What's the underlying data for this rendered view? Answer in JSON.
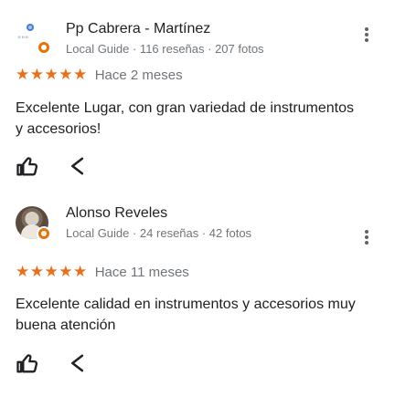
{
  "reviews": [
    {
      "name": "Pp Cabrera - Martínez",
      "meta": "Local Guide · 116 reseñas · 207 fotos",
      "stars": "★★★★★",
      "date": "Hace 2 meses",
      "text": "Excelente Lugar, con gran variedad de instrumentos y accesorios!",
      "rating": 5
    },
    {
      "name": "Alonso Reveles",
      "meta": "Local Guide · 24 reseñas · 42 fotos",
      "stars": "★★★★★",
      "date": "Hace 11 meses",
      "text": "Excelente calidad en instrumentos y accesorios muy buena atención",
      "rating": 5
    }
  ],
  "icons": {
    "like": "thumb-up-outline-icon",
    "share": "share-icon",
    "more": "more-vert-icon",
    "badge": "local-guide-badge-icon"
  },
  "colors": {
    "star": "#e7711b",
    "badge": "#e8710a",
    "secondary_text": "#70757a",
    "primary_text": "#202124"
  }
}
